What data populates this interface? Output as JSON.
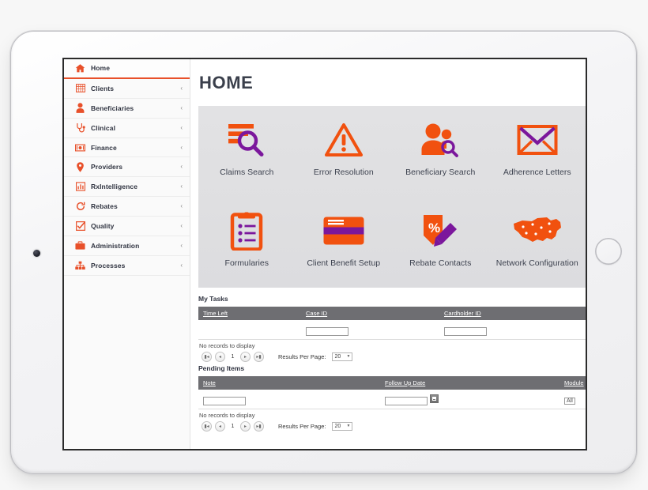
{
  "device": {
    "name": "tablet",
    "camera_icon": "camera-dot-icon",
    "home_button_icon": "home-button-icon"
  },
  "sidebar": {
    "items": [
      {
        "label": "Home",
        "icon": "home-icon",
        "active": true,
        "chevron": ""
      },
      {
        "label": "Clients",
        "icon": "grid-icon",
        "active": false,
        "chevron": "‹"
      },
      {
        "label": "Beneficiaries",
        "icon": "user-icon",
        "active": false,
        "chevron": "‹"
      },
      {
        "label": "Clinical",
        "icon": "stethoscope-icon",
        "active": false,
        "chevron": "‹"
      },
      {
        "label": "Finance",
        "icon": "money-icon",
        "active": false,
        "chevron": "‹"
      },
      {
        "label": "Providers",
        "icon": "map-pin-icon",
        "active": false,
        "chevron": "‹"
      },
      {
        "label": "RxIntelligence",
        "icon": "bar-chart-icon",
        "active": false,
        "chevron": "‹"
      },
      {
        "label": "Rebates",
        "icon": "refresh-icon",
        "active": false,
        "chevron": "‹"
      },
      {
        "label": "Quality",
        "icon": "check-square-icon",
        "active": false,
        "chevron": "‹"
      },
      {
        "label": "Administration",
        "icon": "briefcase-icon",
        "active": false,
        "chevron": "‹"
      },
      {
        "label": "Processes",
        "icon": "sitemap-icon",
        "active": false,
        "chevron": "‹"
      }
    ]
  },
  "main": {
    "title": "HOME",
    "tiles": [
      {
        "label": "Claims Search",
        "icon": "claims-search-icon"
      },
      {
        "label": "Error Resolution",
        "icon": "warning-triangle-icon"
      },
      {
        "label": "Beneficiary Search",
        "icon": "beneficiary-search-icon"
      },
      {
        "label": "Adherence Letters",
        "icon": "envelope-icon"
      },
      {
        "label": "Formularies",
        "icon": "clipboard-list-icon"
      },
      {
        "label": "Client Benefit Setup",
        "icon": "id-card-icon"
      },
      {
        "label": "Rebate Contacts",
        "icon": "percent-tag-pencil-icon"
      },
      {
        "label": "Network Configuration",
        "icon": "usa-map-icon"
      }
    ]
  },
  "my_tasks": {
    "section_title": "My Tasks",
    "columns": [
      "Time Left",
      "Case ID",
      "Cardholder ID"
    ],
    "filters": {
      "time_left": "",
      "case_id": "",
      "cardholder_id": ""
    },
    "empty_message": "No records to display",
    "pager": {
      "first_label": "⏮",
      "prev_label": "◀",
      "page": "1",
      "next_label": "▶",
      "last_label": "⏭",
      "results_per_page_label": "Results Per Page:",
      "results_per_page_value": "20"
    }
  },
  "pending_items": {
    "section_title": "Pending Items",
    "columns": [
      "Note",
      "Follow Up Date",
      "Module"
    ],
    "filters": {
      "note": "",
      "follow_up_date": "",
      "module": "All"
    },
    "calendar_icon": "calendar-icon",
    "empty_message": "No records to display",
    "pager": {
      "first_label": "⏮",
      "prev_label": "◀",
      "page": "1",
      "next_label": "▶",
      "last_label": "⏭",
      "results_per_page_label": "Results Per Page:",
      "results_per_page_value": "20"
    }
  },
  "colors": {
    "accent_orange": "#f1510f",
    "accent_purple": "#7b179c",
    "nav_red": "#e8502a",
    "header_gray": "#6e6e72",
    "tile_panel_gray": "#e0e0e2",
    "title_text": "#3a3f4b"
  }
}
